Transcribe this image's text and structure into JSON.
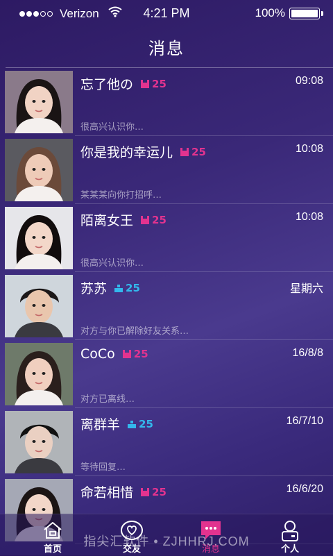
{
  "status_bar": {
    "carrier": "Verizon",
    "time": "4:21 PM",
    "battery": "100%",
    "signal_bars_filled": 3,
    "signal_bars_total": 5
  },
  "header": {
    "title": "消息"
  },
  "conversations": [
    {
      "name": "忘了他の",
      "gender": "female",
      "level": "25",
      "time": "09:08",
      "preview": "很高兴认识你…",
      "avatar": "female-avatar"
    },
    {
      "name": "你是我的幸运儿",
      "gender": "female",
      "level": "25",
      "time": "10:08",
      "preview": "某某某向你打招呼…",
      "avatar": "female-avatar"
    },
    {
      "name": "陌离女王",
      "gender": "female",
      "level": "25",
      "time": "10:08",
      "preview": "很高兴认识你…",
      "avatar": "female-avatar"
    },
    {
      "name": "苏苏",
      "gender": "male",
      "level": "25",
      "time": "星期六",
      "preview": "对方与你已解除好友关系…",
      "avatar": "male-avatar"
    },
    {
      "name": "CoCo",
      "gender": "female",
      "level": "25",
      "time": "16/8/8",
      "preview": "对方已离线…",
      "avatar": "female-avatar"
    },
    {
      "name": "离群羊",
      "gender": "male",
      "level": "25",
      "time": "16/7/10",
      "preview": "等待回复…",
      "avatar": "male-avatar"
    },
    {
      "name": "命若相惜",
      "gender": "female",
      "level": "25",
      "time": "16/6/20",
      "preview": "",
      "avatar": "female-avatar"
    }
  ],
  "tabs": [
    {
      "label": "首页",
      "icon": "home-icon",
      "active": false
    },
    {
      "label": "交友",
      "icon": "heart-chat-icon",
      "active": false
    },
    {
      "label": "消息",
      "icon": "message-icon",
      "active": true
    },
    {
      "label": "个人",
      "icon": "person-icon",
      "active": false
    }
  ],
  "watermark": "指尖汇软件 • ZJHHRJ.COM",
  "colors": {
    "female_badge": "#e2338f",
    "male_badge": "#33b8ec",
    "active_tab": "#e2338f"
  }
}
